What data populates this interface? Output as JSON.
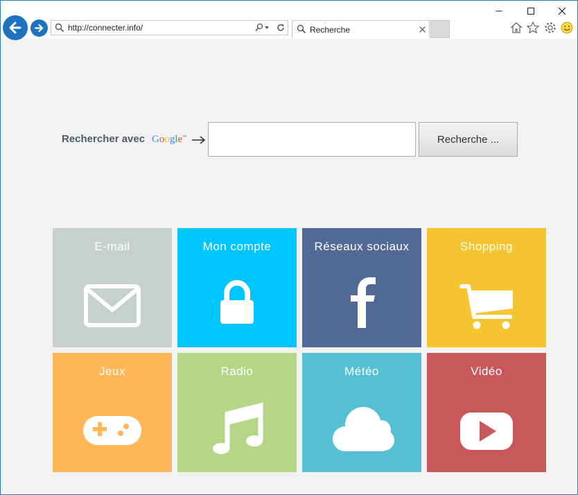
{
  "browser": {
    "address_url": "http://connecter.info/",
    "tab_title": "Recherche"
  },
  "search": {
    "label": "Rechercher avec",
    "google_tm": "™",
    "button_label": "Recherche ...",
    "input_value": ""
  },
  "tiles": [
    {
      "label": "E-mail",
      "color": "#c8d0cc",
      "icon": "mail-icon"
    },
    {
      "label": "Mon compte",
      "color": "#00c6ff",
      "icon": "lock-icon"
    },
    {
      "label": "Réseaux sociaux",
      "color": "#526996",
      "icon": "facebook-icon"
    },
    {
      "label": "Shopping",
      "color": "#f5c531",
      "icon": "cart-icon"
    },
    {
      "label": "Jeux",
      "color": "#ffb757",
      "icon": "gamepad-icon"
    },
    {
      "label": "Radio",
      "color": "#b3d687",
      "icon": "music-icon"
    },
    {
      "label": "Météo",
      "color": "#55c0d4",
      "icon": "cloud-icon"
    },
    {
      "label": "Vidéo",
      "color": "#c9585b",
      "icon": "play-icon"
    }
  ]
}
